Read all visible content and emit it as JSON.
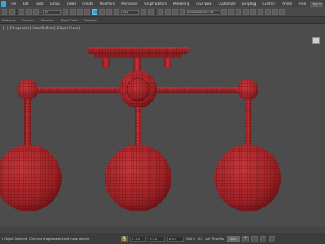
{
  "menubar": {
    "items": [
      "File",
      "Edit",
      "Tools",
      "Group",
      "Views",
      "Create",
      "Modifiers",
      "Animation",
      "Graph Editors",
      "Rendering",
      "Civil View",
      "Customize",
      "Scripting",
      "Content",
      "Arnold",
      "Help"
    ],
    "search": "Sign In"
  },
  "toolbar": {
    "selection_filter": "All",
    "reference_coord": "View",
    "named_selection": "Create Selection Set"
  },
  "ribbon": {
    "tabs": [
      "Modeling",
      "Freeform",
      "Selection",
      "Object Paint",
      "Populate"
    ]
  },
  "viewport": {
    "label": "[+] [Perspective] [User Defined] [Edged Faces]",
    "object_color": "#a8262b"
  },
  "statusbar": {
    "selection": "1 Object Selected",
    "hint": "Click and drag to select and move objects",
    "x": "X: -0.0",
    "y": "Y: 0.0",
    "z": "Z: 0.0",
    "grid": "Grid = 10.0",
    "add_time_tag": "Add Time Tag",
    "key_mode": "Auto",
    "selected": "Selected"
  }
}
